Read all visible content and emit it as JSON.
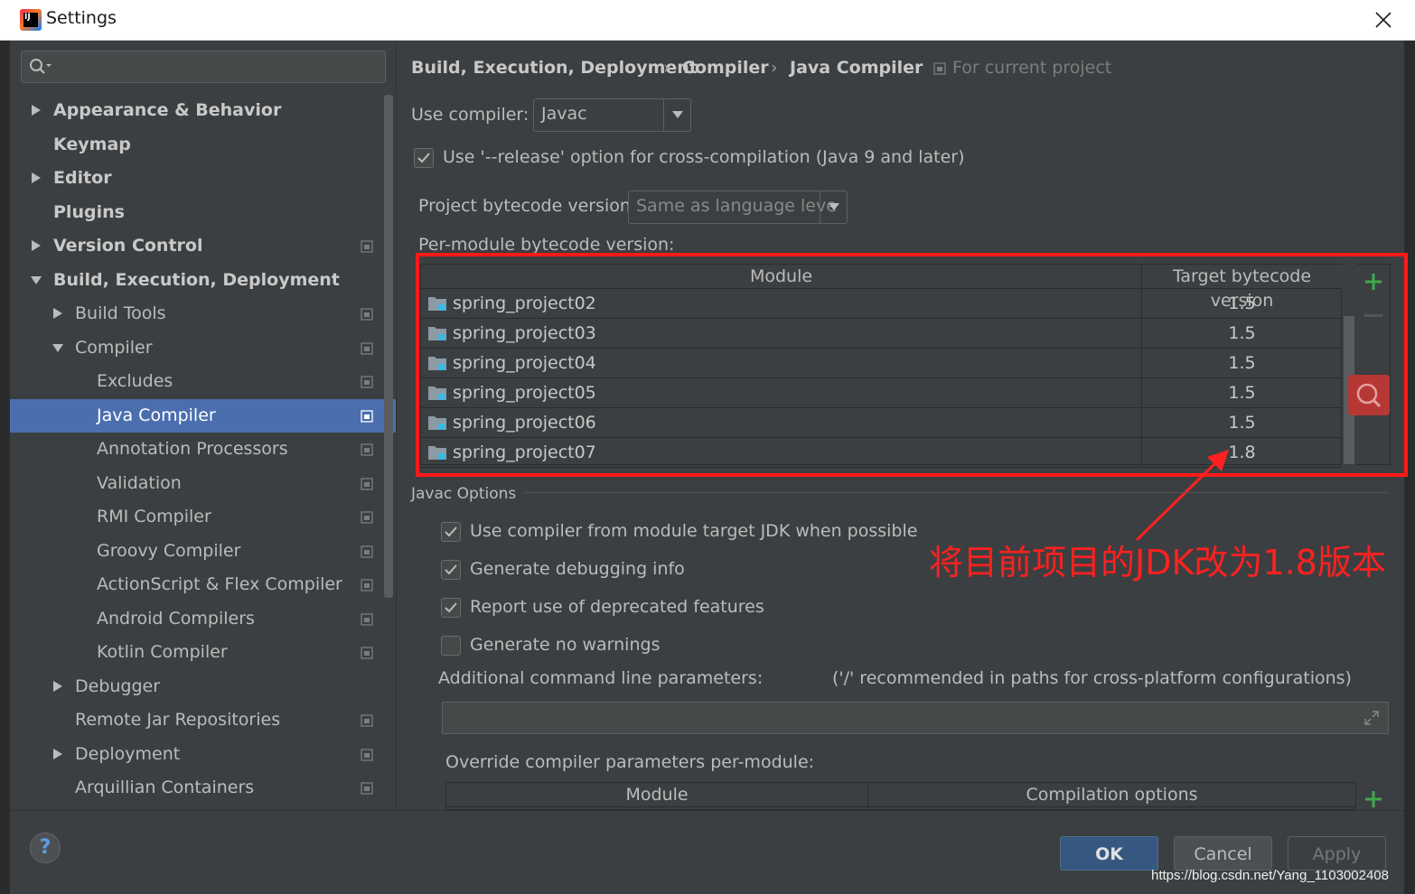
{
  "window": {
    "title": "Settings"
  },
  "search": {
    "placeholder": ""
  },
  "sidebar": {
    "items": [
      {
        "label": "Appearance & Behavior",
        "bold": true,
        "arrow": "right"
      },
      {
        "label": "Keymap",
        "bold": true
      },
      {
        "label": "Editor",
        "bold": true,
        "arrow": "right"
      },
      {
        "label": "Plugins",
        "bold": true
      },
      {
        "label": "Version Control",
        "bold": true,
        "arrow": "right",
        "scope": true
      },
      {
        "label": "Build, Execution, Deployment",
        "bold": true,
        "arrow": "down"
      },
      {
        "label": "Build Tools",
        "arrow": "right",
        "scope": true
      },
      {
        "label": "Compiler",
        "arrow": "down",
        "scope": true
      },
      {
        "label": "Excludes",
        "scope": true
      },
      {
        "label": "Java Compiler",
        "selected": true,
        "scope": true
      },
      {
        "label": "Annotation Processors",
        "scope": true
      },
      {
        "label": "Validation",
        "scope": true
      },
      {
        "label": "RMI Compiler",
        "scope": true
      },
      {
        "label": "Groovy Compiler",
        "scope": true
      },
      {
        "label": "ActionScript & Flex Compiler",
        "scope": true
      },
      {
        "label": "Android Compilers",
        "scope": true
      },
      {
        "label": "Kotlin Compiler",
        "scope": true
      },
      {
        "label": "Debugger",
        "arrow": "right"
      },
      {
        "label": "Remote Jar Repositories",
        "scope": true
      },
      {
        "label": "Deployment",
        "arrow": "right",
        "scope": true
      },
      {
        "label": "Arquillian Containers",
        "scope": true
      }
    ]
  },
  "breadcrumb": {
    "parts": [
      "Build, Execution, Deployment",
      "Compiler",
      "Java Compiler"
    ],
    "separator": "›",
    "scope_label": "For current project"
  },
  "compiler": {
    "use_compiler_label": "Use compiler:",
    "use_compiler_value": "Javac",
    "release_option_label": "Use '--release' option for cross-compilation (Java 9 and later)",
    "release_option_checked": true,
    "project_bytecode_label": "Project bytecode version:",
    "project_bytecode_value": "Same as language leve",
    "per_module_label": "Per-module bytecode version:"
  },
  "module_table": {
    "headers": [
      "Module",
      "Target bytecode version"
    ],
    "rows": [
      {
        "module": "spring_project02",
        "version": "1.5"
      },
      {
        "module": "spring_project03",
        "version": "1.5"
      },
      {
        "module": "spring_project04",
        "version": "1.5"
      },
      {
        "module": "spring_project05",
        "version": "1.5"
      },
      {
        "module": "spring_project06",
        "version": "1.5"
      },
      {
        "module": "spring_project07",
        "version": "1.8"
      }
    ]
  },
  "javac_options": {
    "section_label": "Javac Options",
    "options": [
      {
        "label": "Use compiler from module target JDK when possible",
        "checked": true
      },
      {
        "label": "Generate debugging info",
        "checked": true
      },
      {
        "label": "Report use of deprecated features",
        "checked": true
      },
      {
        "label": "Generate no warnings",
        "checked": false
      }
    ],
    "additional_params_label": "Additional command line parameters:",
    "additional_params_hint": "('/' recommended in paths for cross-platform configurations)",
    "additional_params_value": "",
    "override_label": "Override compiler parameters per-module:",
    "override_headers": [
      "Module",
      "Compilation options"
    ]
  },
  "annotation": {
    "text": "将目前项目的JDK改为1.8版本",
    "color": "#ff2020"
  },
  "footer": {
    "help_label": "?",
    "ok_label": "OK",
    "cancel_label": "Cancel",
    "apply_label": "Apply",
    "watermark": "https://blog.csdn.net/Yang_1103002408"
  },
  "colors": {
    "selection": "#4b6eaf",
    "background": "#3c3f41",
    "add": "#3fa84f"
  }
}
